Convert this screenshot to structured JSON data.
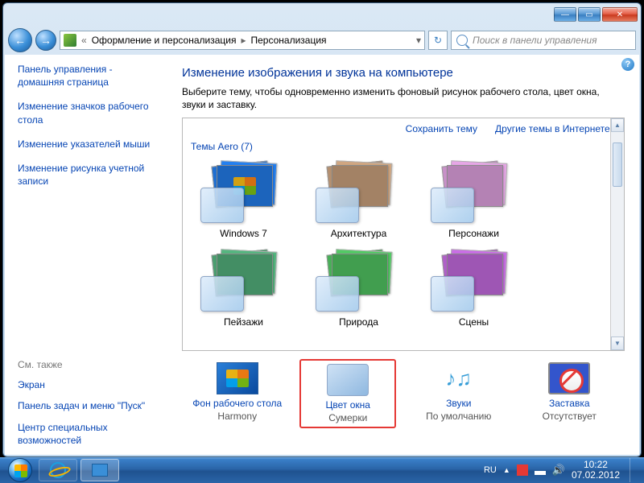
{
  "titlebar": {
    "min": "—",
    "max": "▭",
    "close": "✕"
  },
  "nav": {
    "breadcrumbs": [
      "Оформление и персонализация",
      "Персонализация"
    ],
    "search_placeholder": "Поиск в панели управления",
    "refresh_glyph": "↻"
  },
  "sidebar": {
    "home": "Панель управления - домашняя страница",
    "links": [
      "Изменение значков рабочего стола",
      "Изменение указателей мыши",
      "Изменение рисунка учетной записи"
    ],
    "see_also_label": "См. также",
    "see_also": [
      "Экран",
      "Панель задач и меню \"Пуск\"",
      "Центр специальных возможностей"
    ]
  },
  "main": {
    "title": "Изменение изображения и звука на компьютере",
    "subtitle": "Выберите тему, чтобы одновременно изменить фоновый рисунок рабочего стола, цвет окна, звуки и заставку.",
    "save_theme": "Сохранить тему",
    "more_themes": "Другие темы в Интернете",
    "group_label": "Темы Aero (7)",
    "themes": [
      "Windows 7",
      "Архитектура",
      "Персонажи",
      "Пейзажи",
      "Природа",
      "Сцены"
    ],
    "bottom": [
      {
        "title": "Фон рабочего стола",
        "sub": "Harmony"
      },
      {
        "title": "Цвет окна",
        "sub": "Сумерки"
      },
      {
        "title": "Звуки",
        "sub": "По умолчанию"
      },
      {
        "title": "Заставка",
        "sub": "Отсутствует"
      }
    ],
    "help": "?"
  },
  "taskbar": {
    "lang": "RU",
    "time": "10:22",
    "date": "07.02.2012",
    "tri": "▲"
  },
  "theme_colors": {
    "0": "#1f6fd1",
    "1": "#b59070",
    "2": "#c890c8",
    "3": "#4a9e6f",
    "4": "#48b058",
    "5": "#b060c8"
  }
}
